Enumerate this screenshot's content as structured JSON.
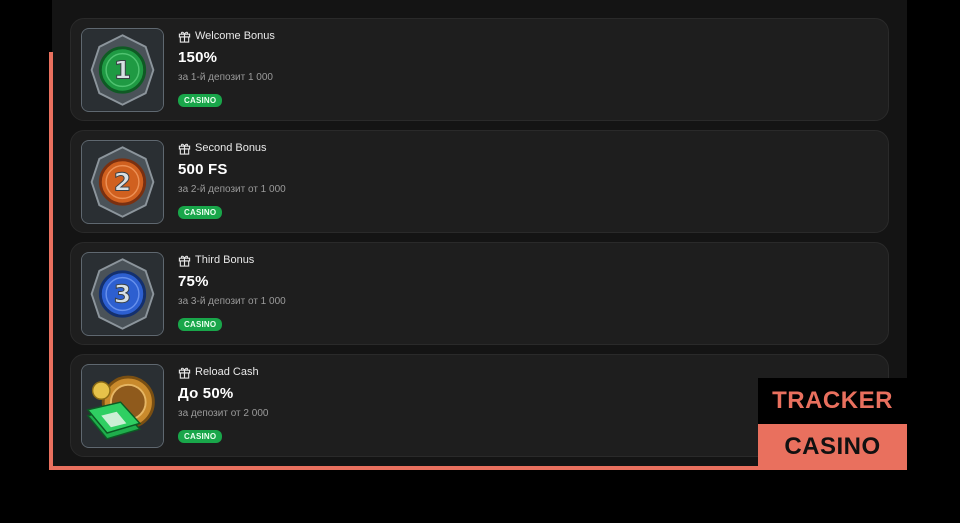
{
  "bonuses": [
    {
      "kind": "Welcome Bonus",
      "amount": "150%",
      "condition": "за 1-й депозит 1 000",
      "tag": "CASINO",
      "badge_numeral": "1",
      "badge_color": "#1f9a43",
      "icon": "gift-icon"
    },
    {
      "kind": "Second Bonus",
      "amount": "500 FS",
      "condition": "за 2-й депозит от 1 000",
      "tag": "CASINO",
      "badge_numeral": "2",
      "badge_color": "#d0601f",
      "icon": "gift-icon"
    },
    {
      "kind": "Third Bonus",
      "amount": "75%",
      "condition": "за 3-й депозит от 1 000",
      "tag": "CASINO",
      "badge_numeral": "3",
      "badge_color": "#2d5fd0",
      "icon": "gift-icon"
    },
    {
      "kind": "Reload Cash",
      "amount": "До 50%",
      "condition": "за депозит от 2 000",
      "tag": "CASINO",
      "badge_numeral": "",
      "badge_color": "#c98a2c",
      "icon": "gift-icon"
    }
  ],
  "watermark": {
    "line1": "TRACKER",
    "line2": "CASINO",
    "accent_color": "#e9705e"
  },
  "colors": {
    "tag_green": "#19a64a",
    "card_bg": "#1e1e1e"
  }
}
